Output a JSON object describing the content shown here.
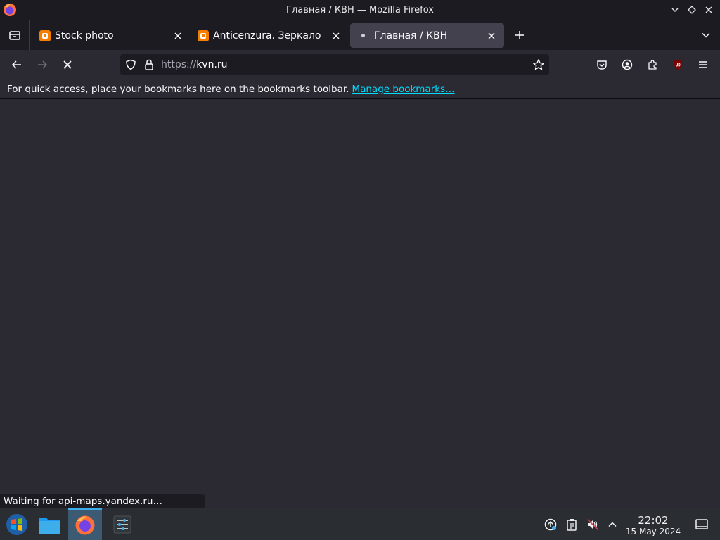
{
  "window": {
    "title": "Главная / КВН — Mozilla Firefox"
  },
  "tabs": [
    {
      "label": "Stock photo",
      "favicon": "blogger-icon",
      "active": false
    },
    {
      "label": "Anticenzura. Зеркало",
      "favicon": "blogger-icon",
      "active": false
    },
    {
      "label": "Главная / КВН",
      "favicon": "loading-dot",
      "active": true
    }
  ],
  "urlbar": {
    "scheme": "https://",
    "host": "kvn.ru"
  },
  "bookmarks_bar": {
    "message": "For quick access, place your bookmarks here on the bookmarks toolbar.",
    "link": "Manage bookmarks…"
  },
  "status": {
    "text": "Waiting for api-maps.yandex.ru…"
  },
  "taskbar": {
    "apps": [
      "start-menu-icon",
      "file-manager-icon",
      "firefox-icon",
      "settings-icon"
    ],
    "clock": {
      "time": "22:02",
      "date": "15 May 2024"
    }
  },
  "colors": {
    "accent": "#00ddff",
    "chrome": "#1c1b22",
    "background": "#2b2a33",
    "taskbar": "#2a2e32"
  }
}
